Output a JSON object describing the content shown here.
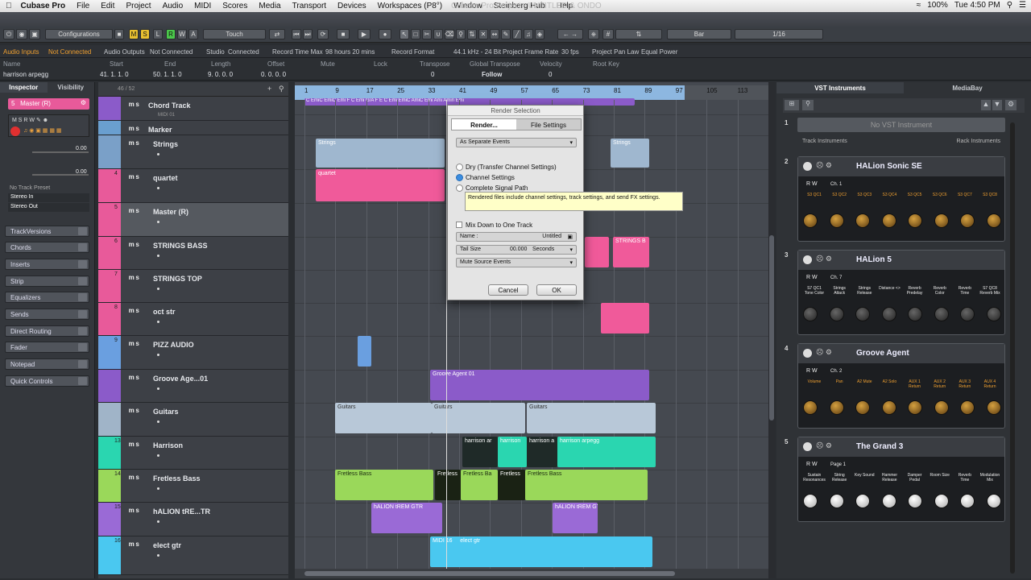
{
  "menubar": {
    "app": "Cubase Pro",
    "items": [
      "File",
      "Edit",
      "Project",
      "Audio",
      "MIDI",
      "Scores",
      "Media",
      "Transport",
      "Devices",
      "Workspaces (P8°)",
      "Window",
      "Steinberg Hub",
      "Help"
    ],
    "window_title": "Cubase Pro Project - UNTITLED & ONDO",
    "battery": "100%",
    "clock": "Tue 4:50 PM"
  },
  "toolbar": {
    "configurations": "Configurations",
    "mode_letters": [
      "M",
      "S",
      "L",
      "R",
      "W",
      "A"
    ],
    "touch": "Touch",
    "grid_type": "Bar",
    "quantize": "1/16"
  },
  "status": {
    "audio_inputs": "Audio Inputs",
    "audio_inputs_val": "Not Connected",
    "audio_outputs": "Audio Outputs",
    "audio_outputs_val": "Not Connected",
    "studio": "Studio",
    "studio_val": "Connected",
    "rec_time": "Record Time Max",
    "rec_time_val": "98 hours 20 mins",
    "rec_format": "Record Format",
    "rec_format_val": "44.1 kHz - 24 Bit",
    "frame_rate": "Project Frame Rate",
    "frame_rate_val": "30 fps",
    "pan_law": "Project Pan Law",
    "pan_law_val": "Equal Power"
  },
  "info": {
    "headers": [
      "Name",
      "Start",
      "End",
      "Length",
      "Offset",
      "Mute",
      "Lock",
      "Transpose",
      "Global Transpose",
      "Velocity",
      "Root Key"
    ],
    "name": "harrison arpegg",
    "start": "41. 1. 1.   0",
    "end": "50. 1. 1.   0",
    "length": "9. 0. 0.   0",
    "offset": "0. 0. 0.   0",
    "transpose": "0",
    "global_transpose": "Follow",
    "velocity": "0"
  },
  "inspector": {
    "tabs": [
      "Inspector",
      "Visibility"
    ],
    "track": "Master (R)",
    "track_num": "5",
    "val1": "0.00",
    "val2": "0.00",
    "no_preset": "No Track Preset",
    "stereo_in": "Stereo In",
    "stereo_out": "Stereo Out",
    "sections": [
      "TrackVersions",
      "Chords",
      "Inserts",
      "Strip",
      "Equalizers",
      "Sends",
      "Direct Routing",
      "Fader",
      "Notepad",
      "Quick Controls"
    ]
  },
  "tracklist": {
    "counter": "46 / 52",
    "tracks": [
      {
        "name": "Chord Track",
        "num": "",
        "color": "#8b5bc9",
        "sub": "MIDI 01"
      },
      {
        "name": "Marker",
        "num": "",
        "color": "#6a9fd0"
      },
      {
        "name": "Strings",
        "num": "",
        "color": "#7aa0c8"
      },
      {
        "name": "quartet",
        "num": "4",
        "color": "#e85a9a"
      },
      {
        "name": "Master (R)",
        "num": "5",
        "color": "#e85a9a"
      },
      {
        "name": "STRINGS BASS",
        "num": "6",
        "color": "#e85a9a"
      },
      {
        "name": "STRINGS TOP",
        "num": "7",
        "color": "#e85a9a"
      },
      {
        "name": "oct str",
        "num": "8",
        "color": "#e85a9a"
      },
      {
        "name": "PIZZ AUDIO",
        "num": "9",
        "color": "#6a9fe0"
      },
      {
        "name": "Groove Age...01",
        "num": "",
        "color": "#8b5bc9"
      },
      {
        "name": "Guitars",
        "num": "",
        "color": "#a0b4c8"
      },
      {
        "name": "Harrison",
        "num": "13",
        "color": "#2ad6b0"
      },
      {
        "name": "Fretless Bass",
        "num": "14",
        "color": "#9ad85a"
      },
      {
        "name": "hALION tRE...TR",
        "num": "15",
        "color": "#9a6ad6"
      },
      {
        "name": "elect gtr",
        "num": "16",
        "color": "#4ac8f0"
      }
    ]
  },
  "ruler": {
    "marks": [
      "1",
      "9",
      "17",
      "25",
      "33",
      "41",
      "49",
      "57",
      "65",
      "73",
      "81",
      "89",
      "97",
      "105",
      "113"
    ]
  },
  "clips": {
    "strings": "Strings",
    "quartet": "quartet",
    "quartet_b": "Di 14",
    "strings_bass": "STRINGS B",
    "groove": "Groove Agent 01",
    "guitars": "Guitars",
    "harrison_a": "harrison ar",
    "harrison_b": "harrison",
    "harrison_c": "harrison a",
    "harrison_d": "harrison arpegg",
    "fretless": "Fretless Bass",
    "fretless_b": "Fretless",
    "fretless_c": "Fretless Ba",
    "halion": "hALION tREM GTR",
    "elect": "elect gtr",
    "midi": "MIDI 16",
    "chords": "C  EmiC EmiC Emi F  C Emi G/A F  E  C Emi EmiC AmiC Emi Ami Amin Emi"
  },
  "dialog": {
    "title": "Render Selection",
    "tabs": [
      "Render...",
      "File Settings"
    ],
    "mode": "As Separate Events",
    "opt1": "Dry (Transfer Channel Settings)",
    "opt2": "Channel Settings",
    "opt3": "Complete Signal Path",
    "mixdown": "Mix Down to One Track",
    "name_label": "Name :",
    "name_val": "Untitled",
    "tail_label": "Tail Size",
    "tail_val": "00.000",
    "tail_unit": "Seconds",
    "mute": "Mute Source Events",
    "cancel": "Cancel",
    "ok": "OK"
  },
  "tooltip": "Rendered files include channel settings, track settings, and send FX settings.",
  "right": {
    "tabs": [
      "VST Instruments",
      "MediaBay"
    ],
    "no_inst": "No VST Instrument",
    "track_instr": "Track Instruments",
    "rack_instr": "Rack Instruments",
    "instruments": [
      {
        "slot": "2",
        "name": "HALion Sonic SE",
        "ch": "Ch. 1",
        "params": [
          "S3 QC1",
          "S3 QC2",
          "S3 QC3",
          "S3 QC4",
          "S3 QC5",
          "S3 QC6",
          "S3 QC7",
          "S3 QC8"
        ],
        "knob": "gold"
      },
      {
        "slot": "3",
        "name": "HALion 5",
        "ch": "Ch. 7",
        "params": [
          "S7 QC1 Tone Color",
          "Strings Attack",
          "Strings Release",
          "Distance <>",
          "Reverb Predelay",
          "Reverb Color",
          "Reverb Time",
          "S7 QC8 Reverb Mix"
        ],
        "knob": "dark"
      },
      {
        "slot": "4",
        "name": "Groove Agent",
        "ch": "Ch. 2",
        "params": [
          "Volume",
          "Pan",
          "A2 Mute",
          "A2 Solo",
          "AUX 1 Return",
          "AUX 2 Return",
          "AUX 3 Return",
          "AUX 4 Return"
        ],
        "knob": "gold"
      },
      {
        "slot": "5",
        "name": "The Grand 3",
        "ch": "Page 1",
        "params": [
          "Sustain Resonances",
          "String Release",
          "Key Sound",
          "Hammer Release",
          "Damper Pedal",
          "Room Size",
          "Reverb Time",
          "Modulation Mix"
        ],
        "knob": "white"
      }
    ]
  }
}
